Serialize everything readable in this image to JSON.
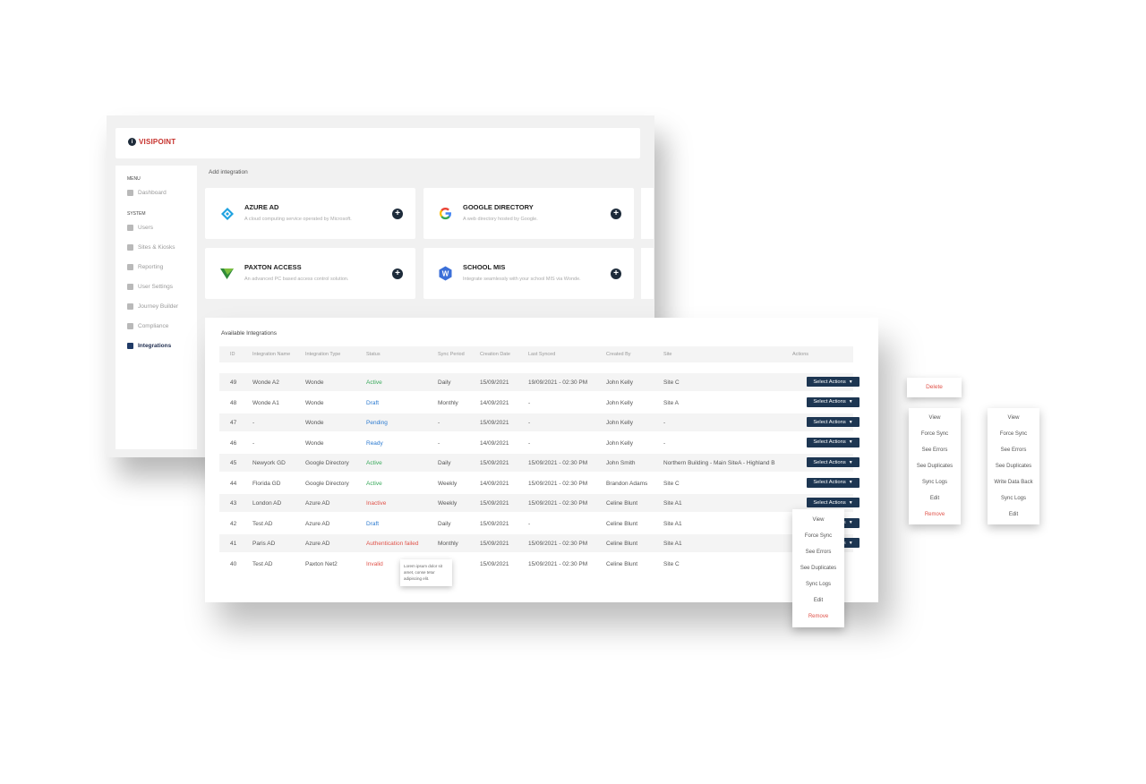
{
  "app": {
    "logo_text": "VISIPOINT"
  },
  "sidebar": {
    "menu_label": "MENU",
    "system_label": "SYSTEM",
    "items": [
      {
        "label": "Dashboard",
        "icon": "home-icon"
      },
      {
        "label": "Users",
        "icon": "users-icon"
      },
      {
        "label": "Sites & Kiosks",
        "icon": "kiosk-icon"
      },
      {
        "label": "Reporting",
        "icon": "report-icon"
      },
      {
        "label": "User Settings",
        "icon": "user-settings-icon"
      },
      {
        "label": "Journey Builder",
        "icon": "journey-icon"
      },
      {
        "label": "Compliance",
        "icon": "compliance-icon"
      },
      {
        "label": "Integrations",
        "icon": "sync-icon",
        "active": true
      }
    ]
  },
  "add_integration": {
    "title": "Add integration",
    "cards": [
      {
        "title": "AZURE AD",
        "desc": "A cloud computing service operated by Microsoft."
      },
      {
        "title": "GOOGLE DIRECTORY",
        "desc": "A web directory hosted by Google."
      },
      {
        "title": "PAXTON ACCESS",
        "desc": "An advanced PC based access control solution."
      },
      {
        "title": "SCHOOL MIS",
        "desc": "Integrate seamlessly with your school MIS via Wonde."
      }
    ]
  },
  "table": {
    "title": "Available Integrations",
    "headers": [
      "ID",
      "Integration Name",
      "Integration Type",
      "Status",
      "Sync Period",
      "Creation Date",
      "Last Synced",
      "Created By",
      "Site",
      "Actions"
    ],
    "action_label": "Select Actions",
    "rows": [
      {
        "id": "49",
        "name": "Wonde A2",
        "type": "Wonde",
        "status": "Active",
        "period": "Daily",
        "created": "15/09/2021",
        "synced": "19/09/2021 - 02:30 PM",
        "by": "John Kelly",
        "site": "Site C"
      },
      {
        "id": "48",
        "name": "Wonde A1",
        "type": "Wonde",
        "status": "Draft",
        "period": "Monthly",
        "created": "14/09/2021",
        "synced": "-",
        "by": "John Kelly",
        "site": "Site A"
      },
      {
        "id": "47",
        "name": "-",
        "type": "Wonde",
        "status": "Pending",
        "period": "-",
        "created": "15/09/2021",
        "synced": "-",
        "by": "John Kelly",
        "site": "-"
      },
      {
        "id": "46",
        "name": "-",
        "type": "Wonde",
        "status": "Ready",
        "period": "-",
        "created": "14/09/2021",
        "synced": "-",
        "by": "John Kelly",
        "site": "-"
      },
      {
        "id": "45",
        "name": "Newyork GD",
        "type": "Google Directory",
        "status": "Active",
        "period": "Daily",
        "created": "15/09/2021",
        "synced": "15/09/2021 - 02:30 PM",
        "by": "John Smith",
        "site": "Northern Building - Main SiteA - Highland B"
      },
      {
        "id": "44",
        "name": "Florida GD",
        "type": "Google Directory",
        "status": "Active",
        "period": "Weekly",
        "created": "14/09/2021",
        "synced": "15/09/2021 - 02:30 PM",
        "by": "Brandon Adams",
        "site": "Site C"
      },
      {
        "id": "43",
        "name": "London AD",
        "type": "Azure AD",
        "status": "Inactive",
        "period": "Weekly",
        "created": "15/09/2021",
        "synced": "15/09/2021 - 02:30 PM",
        "by": "Celine Blunt",
        "site": "Site A1"
      },
      {
        "id": "42",
        "name": "Test AD",
        "type": "Azure AD",
        "status": "Draft",
        "period": "Daily",
        "created": "15/09/2021",
        "synced": "-",
        "by": "Celine Blunt",
        "site": "Site A1"
      },
      {
        "id": "41",
        "name": "Paris AD",
        "type": "Azure AD",
        "status": "Authentication failed",
        "period": "Monthly",
        "created": "15/09/2021",
        "synced": "15/09/2021 - 02:30 PM",
        "by": "Celine Blunt",
        "site": "Site A1"
      },
      {
        "id": "40",
        "name": "Test AD",
        "type": "Paxton Net2",
        "status": "Invalid",
        "period": "",
        "created": "15/09/2021",
        "synced": "15/09/2021 - 02:30 PM",
        "by": "Celine Blunt",
        "site": "Site C"
      }
    ],
    "tooltip": "Lorem ipsum dolor sit amet, conse tetur adipiscing elit."
  },
  "menus": {
    "row_menu": [
      "View",
      "Force Sync",
      "See Errors",
      "See Duplicates",
      "Sync Logs",
      "Edit",
      "Remove"
    ],
    "menu_b": [
      "View",
      "Force Sync",
      "See Errors",
      "See Duplicates",
      "Sync Logs",
      "Edit",
      "Remove"
    ],
    "menu_c": [
      "View",
      "Force Sync",
      "See Errors",
      "See Duplicates",
      "Write Data Back",
      "Sync Logs",
      "Edit"
    ],
    "delete_label": "Delete"
  },
  "colors": {
    "brand_red": "#c6312c",
    "navy": "#1d3652",
    "active_green": "#3aaa5c",
    "blue": "#2d7bd0",
    "error_red": "#e0534a"
  }
}
